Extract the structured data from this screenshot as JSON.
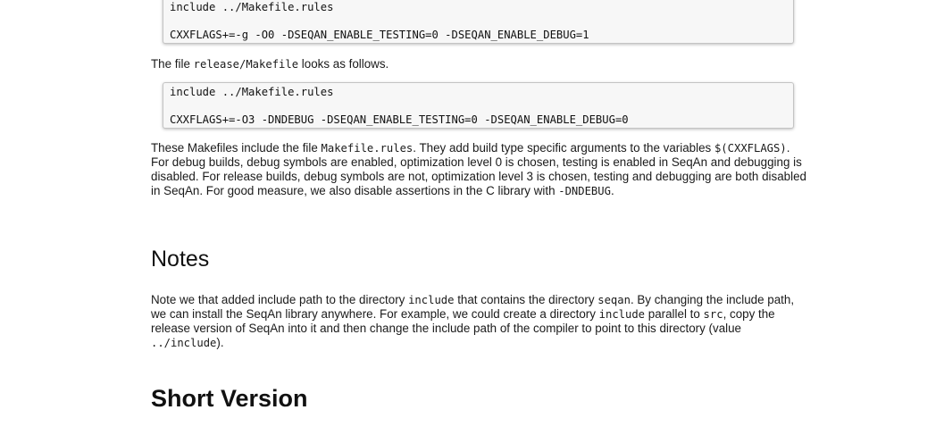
{
  "code_debug": {
    "line1": "include ../Makefile.rules",
    "line2": "CXXFLAGS+=-g -O0 -DSEQAN_ENABLE_TESTING=0 -DSEQAN_ENABLE_DEBUG=1"
  },
  "release_intro": {
    "before": "The file ",
    "path": "release/Makefile",
    "after": " looks as follows."
  },
  "code_release": {
    "line1": "include ../Makefile.rules",
    "line2": "CXXFLAGS+=-O3 -DNDEBUG -DSEQAN_ENABLE_TESTING=0 -DSEQAN_ENABLE_DEBUG=0"
  },
  "makefiles_para": {
    "t1": "These Makefiles include the file ",
    "c1": "Makefile.rules",
    "t2": ". They add build type specific arguments to the variables ",
    "c2": "$(CXXFLAGS)",
    "t3": ". For debug builds, debug symbols are enabled, optimization level 0 is chosen, testing is enabled in SeqAn and debugging is disabled. For release builds, debug symbols are not, optimization level 3 is chosen, testing and debugging are both disabled in SeqAn. For good measure, we also disable assertions in the C library with ",
    "c3": "-DNDEBUG",
    "t4": "."
  },
  "notes_heading": "Notes",
  "notes_para": {
    "t1": "Note we that added include path to the directory ",
    "c1": "include",
    "t2": " that contains the directory ",
    "c2": "seqan",
    "t3": ". By changing the include path, we can install the SeqAn library anywhere. For example, we could create a directory ",
    "c3": "include",
    "t4": " parallel to ",
    "c4": "src",
    "t5": ", copy the release version of SeqAn into it and then change the include path of the compiler to point to this directory (value ",
    "c5": "../include",
    "t6": ")."
  },
  "short_version_heading": "Short Version"
}
